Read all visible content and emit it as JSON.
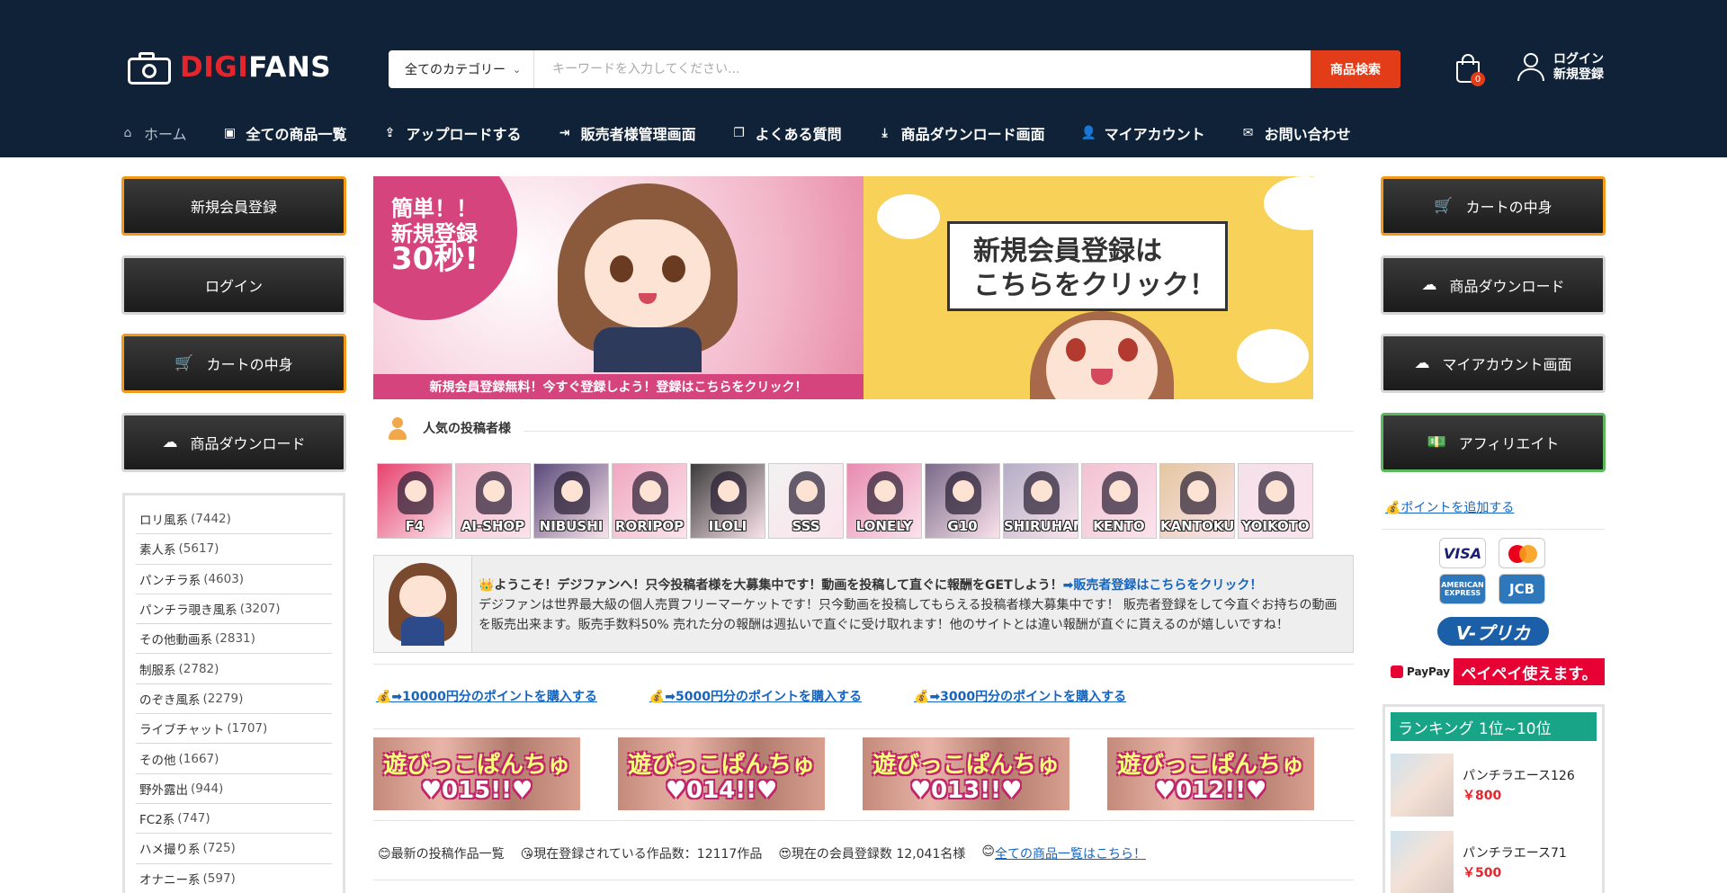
{
  "header": {
    "logo_red": "DIGI",
    "logo_white": "FANS",
    "search_category": "全てのカテゴリー",
    "search_placeholder": "キーワードを入力してください...",
    "search_button": "商品検索",
    "cart_count": "0",
    "login": "ログイン",
    "register": "新規登録"
  },
  "nav": [
    {
      "label": "ホーム",
      "icon": "home-icon"
    },
    {
      "label": "全ての商品一覧",
      "icon": "bag-icon"
    },
    {
      "label": "アップロードする",
      "icon": "upload-icon"
    },
    {
      "label": "販売者様管理画面",
      "icon": "login-icon"
    },
    {
      "label": "よくある質問",
      "icon": "copy-icon"
    },
    {
      "label": "商品ダウンロード画面",
      "icon": "download-icon"
    },
    {
      "label": "マイアカウント",
      "icon": "user-icon"
    },
    {
      "label": "お問い合わせ",
      "icon": "mail-icon"
    }
  ],
  "left_buttons": [
    {
      "label": "新規会員登録"
    },
    {
      "label": "ログイン"
    },
    {
      "label": "カートの中身",
      "icon": "cart-icon"
    },
    {
      "label": "商品ダウンロード",
      "icon": "cloud-download-icon"
    }
  ],
  "categories": [
    {
      "name": "ロリ風系",
      "count": "(7442)"
    },
    {
      "name": "素人系",
      "count": "(5617)"
    },
    {
      "name": "パンチラ系",
      "count": "(4603)"
    },
    {
      "name": "パンチラ覗き風系",
      "count": "(3207)"
    },
    {
      "name": "その他動画系",
      "count": "(2831)"
    },
    {
      "name": "制服系",
      "count": "(2782)"
    },
    {
      "name": "のぞき風系",
      "count": "(2279)"
    },
    {
      "name": "ライブチャット",
      "count": "(1707)"
    },
    {
      "name": "その他",
      "count": "(1667)"
    },
    {
      "name": "野外露出",
      "count": "(944)"
    },
    {
      "name": "FC2系",
      "count": "(747)"
    },
    {
      "name": "ハメ撮り系",
      "count": "(725)"
    },
    {
      "name": "オナニー系",
      "count": "(597)"
    }
  ],
  "banner": {
    "easy_line1": "簡単！！",
    "easy_line2": "新規登録",
    "easy_line3": "30秒!",
    "strip": "新規会員登録無料！今すぐ登録しよう！登録はこちらをクリック！",
    "sign_line1": "新規会員登録は",
    "sign_line2": "こちらをクリック！"
  },
  "popular": {
    "title": "人気の投稿者様",
    "posters": [
      "F4",
      "AI-SHOP",
      "NIBUSHI",
      "RORIPOP",
      "ILOLI",
      "SSS",
      "LONELY",
      "G10",
      "SHIRUHAME",
      "KENTO",
      "KANTOKU",
      "YOIKOTO"
    ]
  },
  "welcome": {
    "headline": "👑ようこそ！デジファンへ！只今投稿者様を大募集中です！動画を投稿して直ぐに報酬をGETしよう！",
    "headline_link": "➡販売者登録はこちらをクリック！",
    "body": "デジファンは世界最大級の個人売買フリーマーケットです！只今動画を投稿してもらえる投稿者様大募集中です！ 販売者登録をして今直ぐお持ちの動画を販売出来ます。販売手数料50% 売れた分の報酬は週払いで直ぐに受け取れます！他のサイトとは違い報酬が直ぐに貰えるのが嬉しいですね！"
  },
  "points": [
    "💰➡10000円分のポイントを購入する",
    "💰➡5000円分のポイントを購入する",
    "💰➡3000円分のポイントを購入する"
  ],
  "videos": [
    {
      "line1": "遊びっこぱんちゅ",
      "line2": "♥015!!♥"
    },
    {
      "line1": "遊びっこぱんちゅ",
      "line2": "♥014!!♥"
    },
    {
      "line1": "遊びっこぱんちゅ",
      "line2": "♥013!!♥"
    },
    {
      "line1": "遊びっこぱんちゅ",
      "line2": "♥012!!♥"
    }
  ],
  "stats": {
    "latest": "😊最新の投稿作品一覧",
    "works": "😘現在登録されている作品数：12117作品",
    "members": "😍現在の会員登録数 12,041名様",
    "all_link_prefix": "😊",
    "all_link": "全ての商品一覧はこちら！"
  },
  "right_buttons": [
    {
      "label": "カートの中身",
      "icon": "cart-icon"
    },
    {
      "label": "商品ダウンロード",
      "icon": "cloud-download-icon"
    },
    {
      "label": "マイアカウント画面",
      "icon": "cloud-icon"
    },
    {
      "label": "アフィリエイト",
      "icon": "money-icon"
    }
  ],
  "add_points": "💰ポイントを追加する",
  "payments": {
    "visa": "VISA",
    "amex": "AMERICAN EXPRESS",
    "jcb": "JCB",
    "vprika": "V-プリカ",
    "paypay": "PayPay",
    "paypay_banner": "ペイペイ使えます。"
  },
  "ranking": {
    "title": "ランキング 1位~10位",
    "items": [
      {
        "name": "パンチラエース126",
        "price": "￥800"
      },
      {
        "name": "パンチラエース71",
        "price": "￥500"
      }
    ]
  },
  "colors": {
    "header_bg": "#0f2238",
    "accent_red": "#e23d18",
    "orange_border": "#f29a1a",
    "green_border": "#5cb85c",
    "ranking_green": "#18a587",
    "link_blue": "#1565c0"
  }
}
